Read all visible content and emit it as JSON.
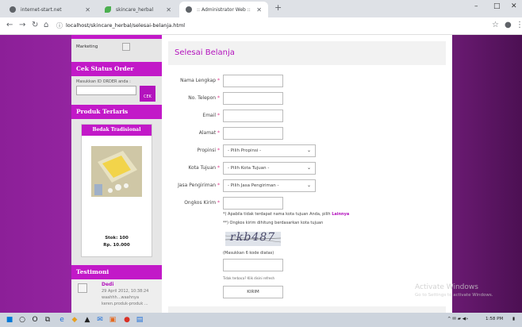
{
  "browser": {
    "tabs": [
      {
        "title": "internet-start.net",
        "icon": "page-icon"
      },
      {
        "title": "skincare_herbal",
        "icon": "leaf-icon"
      },
      {
        "title": ":: Administrator Web ::",
        "icon": "page-icon"
      }
    ],
    "new_tab": "+",
    "url": "localhost/skincare_herbal/selesai-belanja.html"
  },
  "sidebar": {
    "marketing_label": "Marketing",
    "cek_status_heading": "Cek Status Order",
    "order_prompt": "Masukkan ID ORDER anda :",
    "cek_button": "CEK",
    "produk_heading": "Produk Terlaris",
    "product": {
      "name": "Bedak Tradisional",
      "stok": "Stok: 100",
      "price": "Rp. 10.000"
    },
    "testimoni_heading": "Testimoni",
    "testimonial": {
      "name": "Dedi",
      "date": "29 April 2012, 10:38:24",
      "text1": "waahhh...waahnya",
      "text2": "keren.produk-produk ..."
    }
  },
  "main": {
    "title": "Selesai Belanja",
    "fields": {
      "nama": "Nama Lengkap",
      "telepon": "No. Telepon",
      "email": "Email",
      "alamat": "Alamat",
      "propinsi": "Propinsi",
      "kota": "Kota Tujuan",
      "jasa": "Jasa Pengiriman",
      "ongkos": "Ongkos Kirim"
    },
    "required_mark": "*",
    "selects": {
      "propinsi": "- Pilih Propinsi -",
      "kota": "- Pilih Kota Tujuan -",
      "jasa": "- Pilih Jasa Pengiriman -"
    },
    "note1": "*) Apabila tidak terdapat nama kota tujuan Anda, pilih",
    "note1_link": "Lainnya",
    "note2": "**) Ongkos kirim dihitung berdasarkan kota tujuan",
    "captcha_text": "rkb487",
    "captcha_hint": "(Masukkan 6 kode diatas)",
    "captcha_help": "Tidak terbaca? Klik disini refresh",
    "submit": "KIRIM"
  },
  "watermark": {
    "line1": "Activate Windows",
    "line2": "Go to Settings to activate Windows."
  },
  "taskbar": {
    "time": "1:58 PM"
  }
}
